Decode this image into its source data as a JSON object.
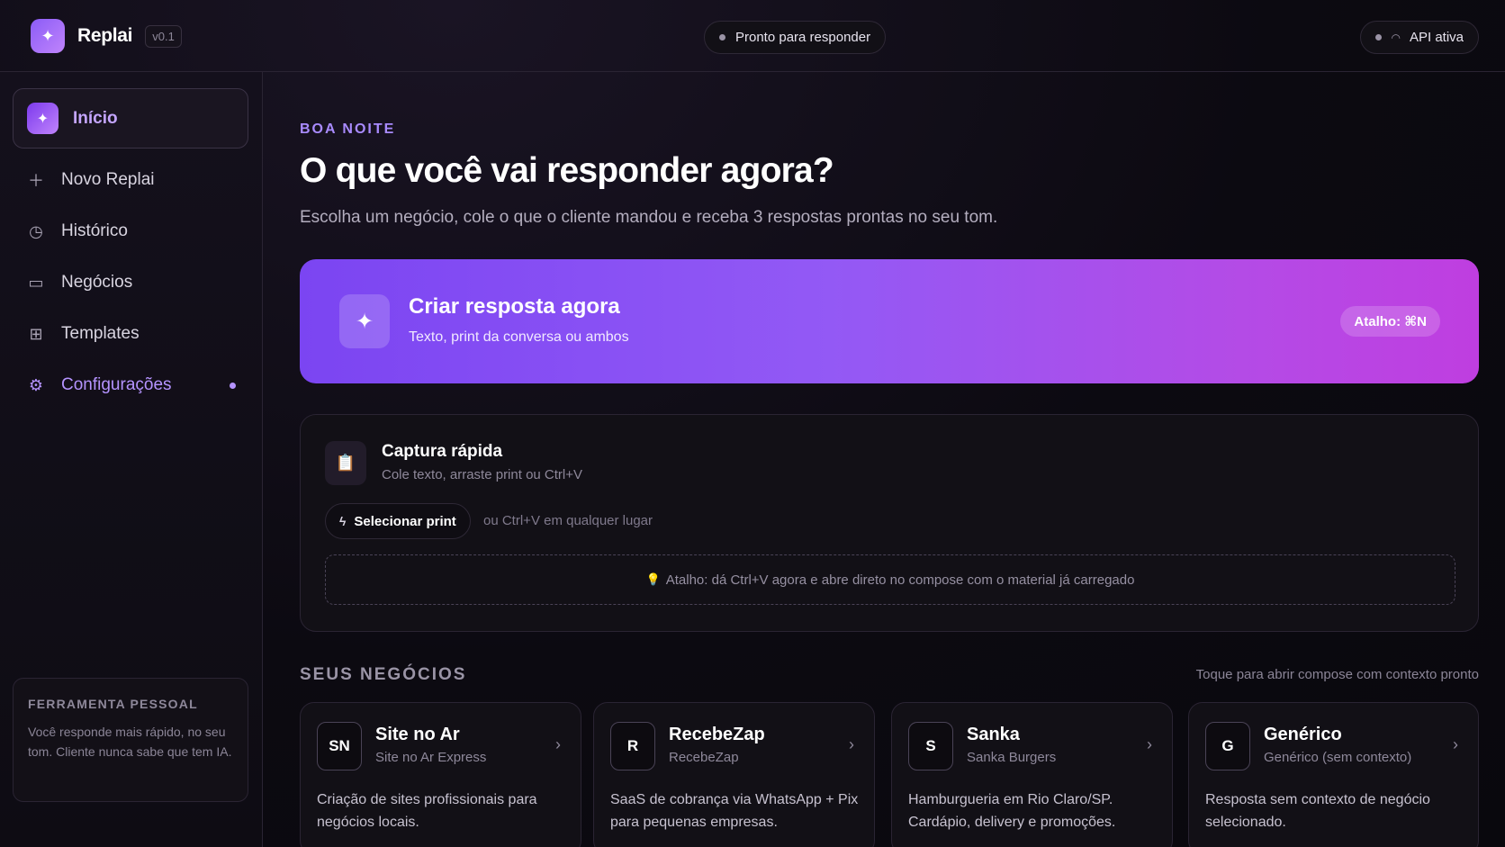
{
  "header": {
    "app_name": "Replai",
    "version": "v0.1",
    "status": "Pronto para responder",
    "api_status": "API ativa"
  },
  "sidebar": {
    "items": [
      {
        "label": "Início",
        "icon": "sparkle-icon",
        "active": true
      },
      {
        "label": "Novo Replai",
        "icon": "plus-icon"
      },
      {
        "label": "Histórico",
        "icon": "history-icon"
      },
      {
        "label": "Negócios",
        "icon": "briefcase-icon"
      },
      {
        "label": "Templates",
        "icon": "grid-icon"
      },
      {
        "label": "Configurações",
        "icon": "gear-icon",
        "badge": true
      }
    ],
    "tool_card": {
      "title": "FERRAMENTA PESSOAL",
      "text": "Você responde mais rápido, no seu tom. Cliente nunca sabe que tem IA."
    }
  },
  "main": {
    "greeting": "BOA NOITE",
    "headline": "O que você vai responder agora?",
    "subline": "Escolha um negócio, cole o que o cliente mandou e receba 3 respostas prontas no seu tom.",
    "cta": {
      "title": "Criar resposta agora",
      "subtitle": "Texto, print da conversa ou ambos",
      "shortcut": "Atalho: ⌘N"
    },
    "capture": {
      "title": "Captura rápida",
      "subtitle": "Cole texto, arraste print ou Ctrl+V",
      "button": "Selecionar print",
      "hint": "ou Ctrl+V em qualquer lugar",
      "drop_zone": "Atalho: dá Ctrl+V agora e abre direto no compose com o material já carregado"
    },
    "businesses": {
      "title": "SEUS NEGÓCIOS",
      "hint": "Toque para abrir compose com contexto pronto",
      "cards": [
        {
          "initials": "SN",
          "name": "Site no Ar",
          "sub": "Site no Ar Express",
          "desc": "Criação de sites profissionais para negócios locais."
        },
        {
          "initials": "R",
          "name": "RecebeZap",
          "sub": "RecebeZap",
          "desc": "SaaS de cobrança via WhatsApp + Pix para pequenas empresas."
        },
        {
          "initials": "S",
          "name": "Sanka",
          "sub": "Sanka Burgers",
          "desc": "Hamburgueria em Rio Claro/SP. Cardápio, delivery e promoções."
        },
        {
          "initials": "G",
          "name": "Genérico",
          "sub": "Genérico (sem contexto)",
          "desc": "Resposta sem contexto de negócio selecionado."
        }
      ]
    }
  },
  "colors": {
    "accent": "#a98bff",
    "cta_start": "#7b45f2",
    "cta_end": "#bf3ee0",
    "background": "#0b0910"
  }
}
